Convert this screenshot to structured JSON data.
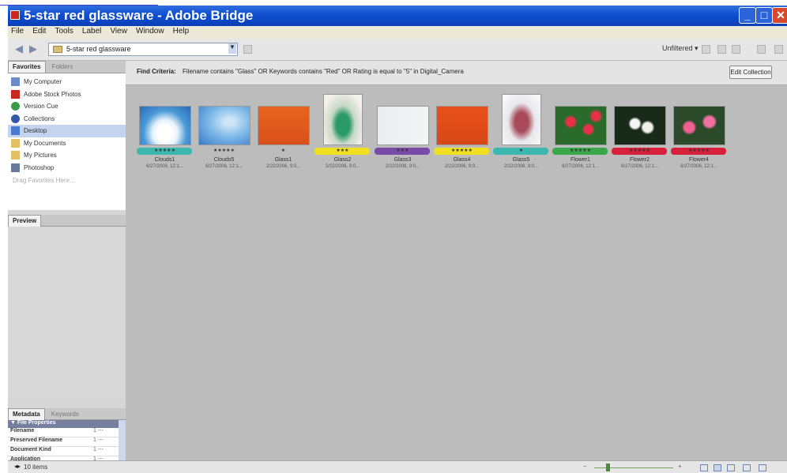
{
  "window": {
    "title": "5-star red glassware - Adobe Bridge"
  },
  "menu": [
    "File",
    "Edit",
    "Tools",
    "Label",
    "View",
    "Window",
    "Help"
  ],
  "toolbar": {
    "path": "5-star red glassware",
    "filter_label": "Unfiltered ▾"
  },
  "left_panel": {
    "tabs": [
      "Favorites",
      "Folders"
    ],
    "favorites": [
      {
        "label": "My Computer",
        "icon": "computer-icon",
        "color": "#6b8cc8"
      },
      {
        "label": "Adobe Stock Photos",
        "icon": "stock-photos-icon",
        "color": "#c8281e"
      },
      {
        "label": "Version Cue",
        "icon": "version-cue-icon",
        "color": "#3a9a4a"
      },
      {
        "label": "Collections",
        "icon": "collections-icon",
        "color": "#3355aa"
      },
      {
        "label": "Desktop",
        "icon": "desktop-icon",
        "color": "#4a7ad0"
      },
      {
        "label": "My Documents",
        "icon": "folder-icon",
        "color": "#e0c060"
      },
      {
        "label": "My Pictures",
        "icon": "pictures-folder-icon",
        "color": "#e0c060"
      },
      {
        "label": "Photoshop",
        "icon": "photoshop-icon",
        "color": "#6a7a9a"
      }
    ],
    "drag_hint": "Drag Favorites Here...",
    "preview_tab": "Preview",
    "meta_tabs": [
      "Metadata",
      "Keywords"
    ],
    "meta_section": "File Properties",
    "meta_rows": [
      {
        "key": "Filename",
        "value": "1 ---"
      },
      {
        "key": "Preserved Filename",
        "value": "1 ---"
      },
      {
        "key": "Document Kind",
        "value": "1 ---"
      },
      {
        "key": "Application",
        "value": "1 ---"
      }
    ]
  },
  "criteria": {
    "label": "Find Criteria:",
    "text": "Filename contains \"Glass\" OR Keywords contains \"Red\" OR Rating is equal to \"5\" in Digital_Camera",
    "edit_button": "Edit Collection"
  },
  "thumbnails": [
    {
      "name": "Clouds1",
      "date": "6/27/2006, 12:1...",
      "stars": "★★★★★",
      "label_color": "#3ab8b0",
      "img": "clouds"
    },
    {
      "name": "Clouds5",
      "date": "6/27/2006, 12:1...",
      "stars": "★★★★★",
      "label_color": "",
      "img": "sky"
    },
    {
      "name": "Glass1",
      "date": "2/22/2006, 9:0...",
      "stars": "★",
      "label_color": "",
      "img": "orange-vases"
    },
    {
      "name": "Glass2",
      "date": "2/22/2006, 9:0...",
      "stars": "★★★",
      "label_color": "#f0e020",
      "img": "green-vase"
    },
    {
      "name": "Glass3",
      "date": "2/22/2006, 9:0...",
      "stars": "★★★",
      "label_color": "#7a4aa8",
      "img": "green-red-vases"
    },
    {
      "name": "Glass4",
      "date": "2/22/2006, 9:0...",
      "stars": "★★★★★",
      "label_color": "#f0e020",
      "img": "red-bowl"
    },
    {
      "name": "Glass5",
      "date": "2/22/2006, 9:0...",
      "stars": "★",
      "label_color": "#3ab8b0",
      "img": "pink-vase"
    },
    {
      "name": "Flower1",
      "date": "6/27/2006, 12:1...",
      "stars": "★★★★★",
      "label_color": "#3aa84a",
      "img": "red-flowers"
    },
    {
      "name": "Flower2",
      "date": "6/27/2006, 12:1...",
      "stars": "★★★★★",
      "label_color": "#d8203a",
      "img": "white-flowers"
    },
    {
      "name": "Flower4",
      "date": "6/27/2006, 12:1...",
      "stars": "★★★★★",
      "label_color": "#d8203a",
      "img": "pink-flowers"
    }
  ],
  "status": {
    "text": "10 items"
  }
}
